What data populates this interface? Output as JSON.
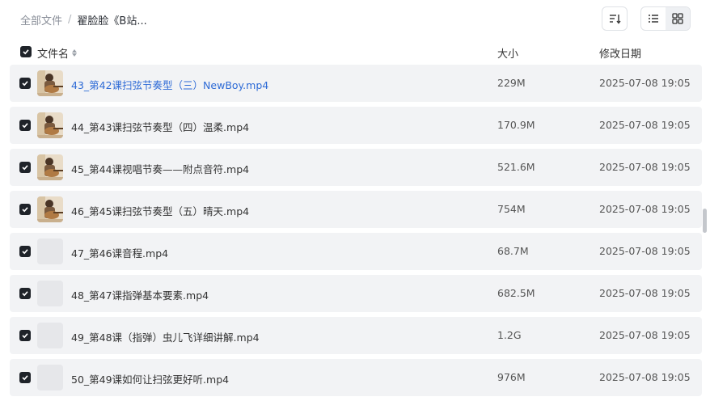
{
  "breadcrumb": {
    "root": "全部文件",
    "separator": "/",
    "current": "翟脸脸《B站..."
  },
  "toolbar": {
    "sort_icon": "sort-icon",
    "list_view_icon": "list-view-icon",
    "grid_view_icon": "grid-view-icon",
    "active_view": "list"
  },
  "table": {
    "headers": {
      "name": "文件名",
      "size": "大小",
      "modified": "修改日期"
    },
    "rows": [
      {
        "name": "43_第42课扫弦节奏型（三）NewBoy.mp4",
        "size": "229M",
        "modified": "2025-07-08 19:05",
        "checked": true,
        "thumbnail": "guitar-video",
        "highlighted": true
      },
      {
        "name": "44_第43课扫弦节奏型（四）温柔.mp4",
        "size": "170.9M",
        "modified": "2025-07-08 19:05",
        "checked": true,
        "thumbnail": "guitar-video",
        "highlighted": false
      },
      {
        "name": "45_第44课视唱节奏——附点音符.mp4",
        "size": "521.6M",
        "modified": "2025-07-08 19:05",
        "checked": true,
        "thumbnail": "guitar-video",
        "highlighted": false
      },
      {
        "name": "46_第45课扫弦节奏型（五）晴天.mp4",
        "size": "754M",
        "modified": "2025-07-08 19:05",
        "checked": true,
        "thumbnail": "guitar-video",
        "highlighted": false
      },
      {
        "name": "47_第46课音程.mp4",
        "size": "68.7M",
        "modified": "2025-07-08 19:05",
        "checked": true,
        "thumbnail": "blank",
        "highlighted": false
      },
      {
        "name": "48_第47课指弹基本要素.mp4",
        "size": "682.5M",
        "modified": "2025-07-08 19:05",
        "checked": true,
        "thumbnail": "blank",
        "highlighted": false
      },
      {
        "name": "49_第48课（指弹）虫儿飞详细讲解.mp4",
        "size": "1.2G",
        "modified": "2025-07-08 19:05",
        "checked": true,
        "thumbnail": "blank",
        "highlighted": false
      },
      {
        "name": "50_第49课如何让扫弦更好听.mp4",
        "size": "976M",
        "modified": "2025-07-08 19:05",
        "checked": true,
        "thumbnail": "blank",
        "highlighted": false
      }
    ]
  },
  "colors": {
    "link": "#2e6bd6",
    "row_bg": "#f2f3f5",
    "checkbox": "#1f2329"
  }
}
